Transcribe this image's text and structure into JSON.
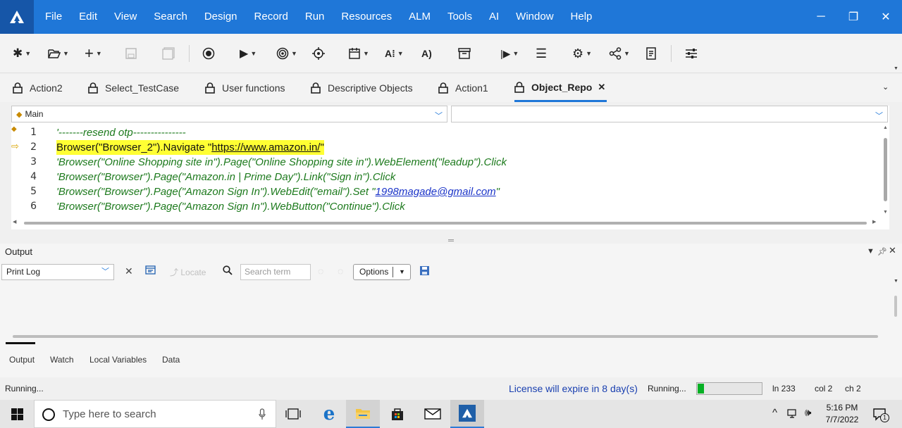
{
  "menubar": {
    "items": [
      "File",
      "Edit",
      "View",
      "Search",
      "Design",
      "Record",
      "Run",
      "Resources",
      "ALM",
      "Tools",
      "AI",
      "Window",
      "Help"
    ]
  },
  "window": {
    "minimize": "─",
    "restore": "❐",
    "close": "✕"
  },
  "tabs": [
    {
      "label": "Action2"
    },
    {
      "label": "Select_TestCase"
    },
    {
      "label": "User functions"
    },
    {
      "label": "Descriptive Objects"
    },
    {
      "label": "Action1"
    },
    {
      "label": "Object_Repo",
      "active": true,
      "close": "✕"
    }
  ],
  "editor": {
    "scope_combo": "Main",
    "function_combo": "",
    "lines": [
      {
        "num": "1",
        "text": "'-------resend otp---------------"
      },
      {
        "num": "2",
        "pre": "Browser(\"Browser_2\").Navigate \"",
        "link": "https://www.amazon.in/",
        "post": "\""
      },
      {
        "num": "3",
        "text": "'Browser(\"Online Shopping site in\").Page(\"Online Shopping site in\").WebElement(\"leadup\").Click"
      },
      {
        "num": "4",
        "text": "'Browser(\"Browser\").Page(\"Amazon.in | Prime Day\").Link(\"Sign in\").Click"
      },
      {
        "num": "5",
        "pre": "'Browser(\"Browser\").Page(\"Amazon Sign In\").WebEdit(\"email\").Set \"",
        "link": "1998magade@gmail.com",
        "post": "\""
      },
      {
        "num": "6",
        "text": "'Browser(\"Browser\").Page(\"Amazon Sign In\").WebButton(\"Continue\").Click"
      }
    ]
  },
  "output": {
    "title": "Output",
    "print_log": "Print Log",
    "locate": "Locate",
    "search_placeholder": "Search term",
    "options": "Options",
    "tabs": [
      "Output",
      "Watch",
      "Local Variables",
      "Data"
    ]
  },
  "status": {
    "left": "Running...",
    "license": "License will expire in 8 day(s)",
    "running": "Running...",
    "progress": 0.1,
    "line": "ln 233",
    "col": "col 2",
    "ch": "ch 2"
  },
  "taskbar": {
    "search_placeholder": "Type here to search",
    "time": "5:16 PM",
    "date": "7/7/2022",
    "notification_count": "1"
  },
  "colors": {
    "accent": "#1f77d8",
    "highlight": "#ffff33",
    "comment": "#1d7a1d",
    "progress": "#06b025"
  }
}
